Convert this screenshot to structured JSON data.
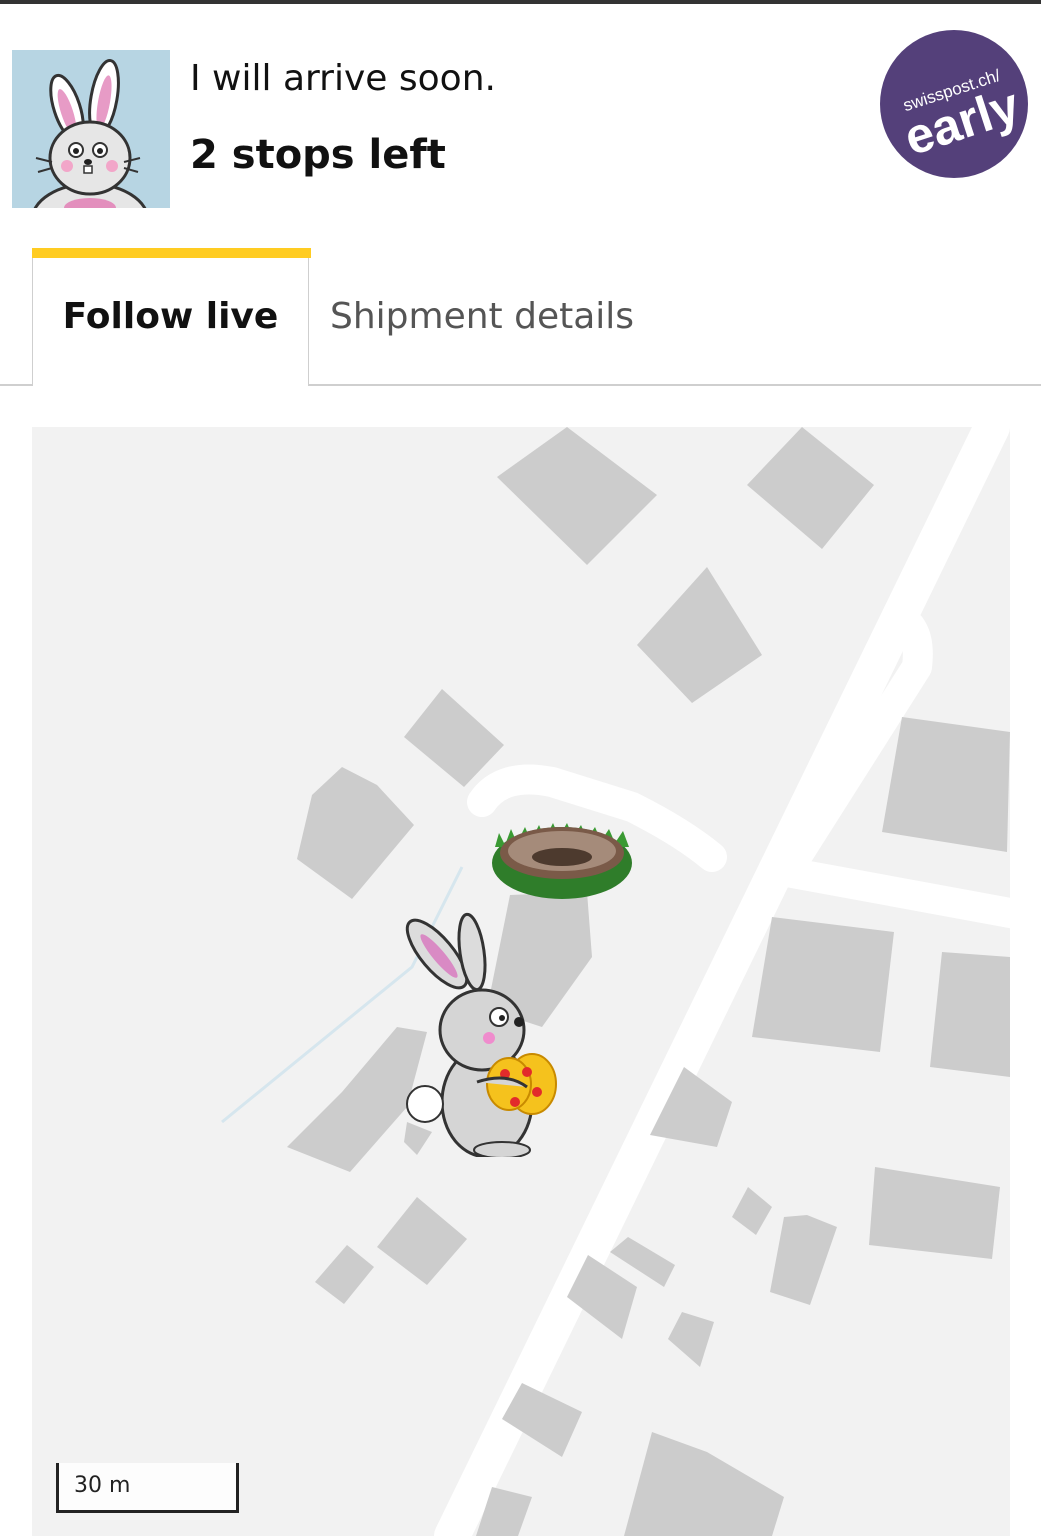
{
  "header": {
    "status_text": "I will arrive soon.",
    "stops_text": "2 stops left",
    "badge": {
      "line1": "swisspost.ch/",
      "line2": "early",
      "color": "#54407a"
    }
  },
  "tabs": [
    {
      "label": "Follow live",
      "active": true
    },
    {
      "label": "Shipment details",
      "active": false
    }
  ],
  "colors": {
    "accent": "#ffcc22",
    "map_background": "#f2f2f2",
    "building": "#cccccc"
  },
  "map": {
    "scale_label": "30 m",
    "markers": [
      {
        "name": "nest-icon"
      },
      {
        "name": "bunny-courier-icon"
      }
    ]
  }
}
